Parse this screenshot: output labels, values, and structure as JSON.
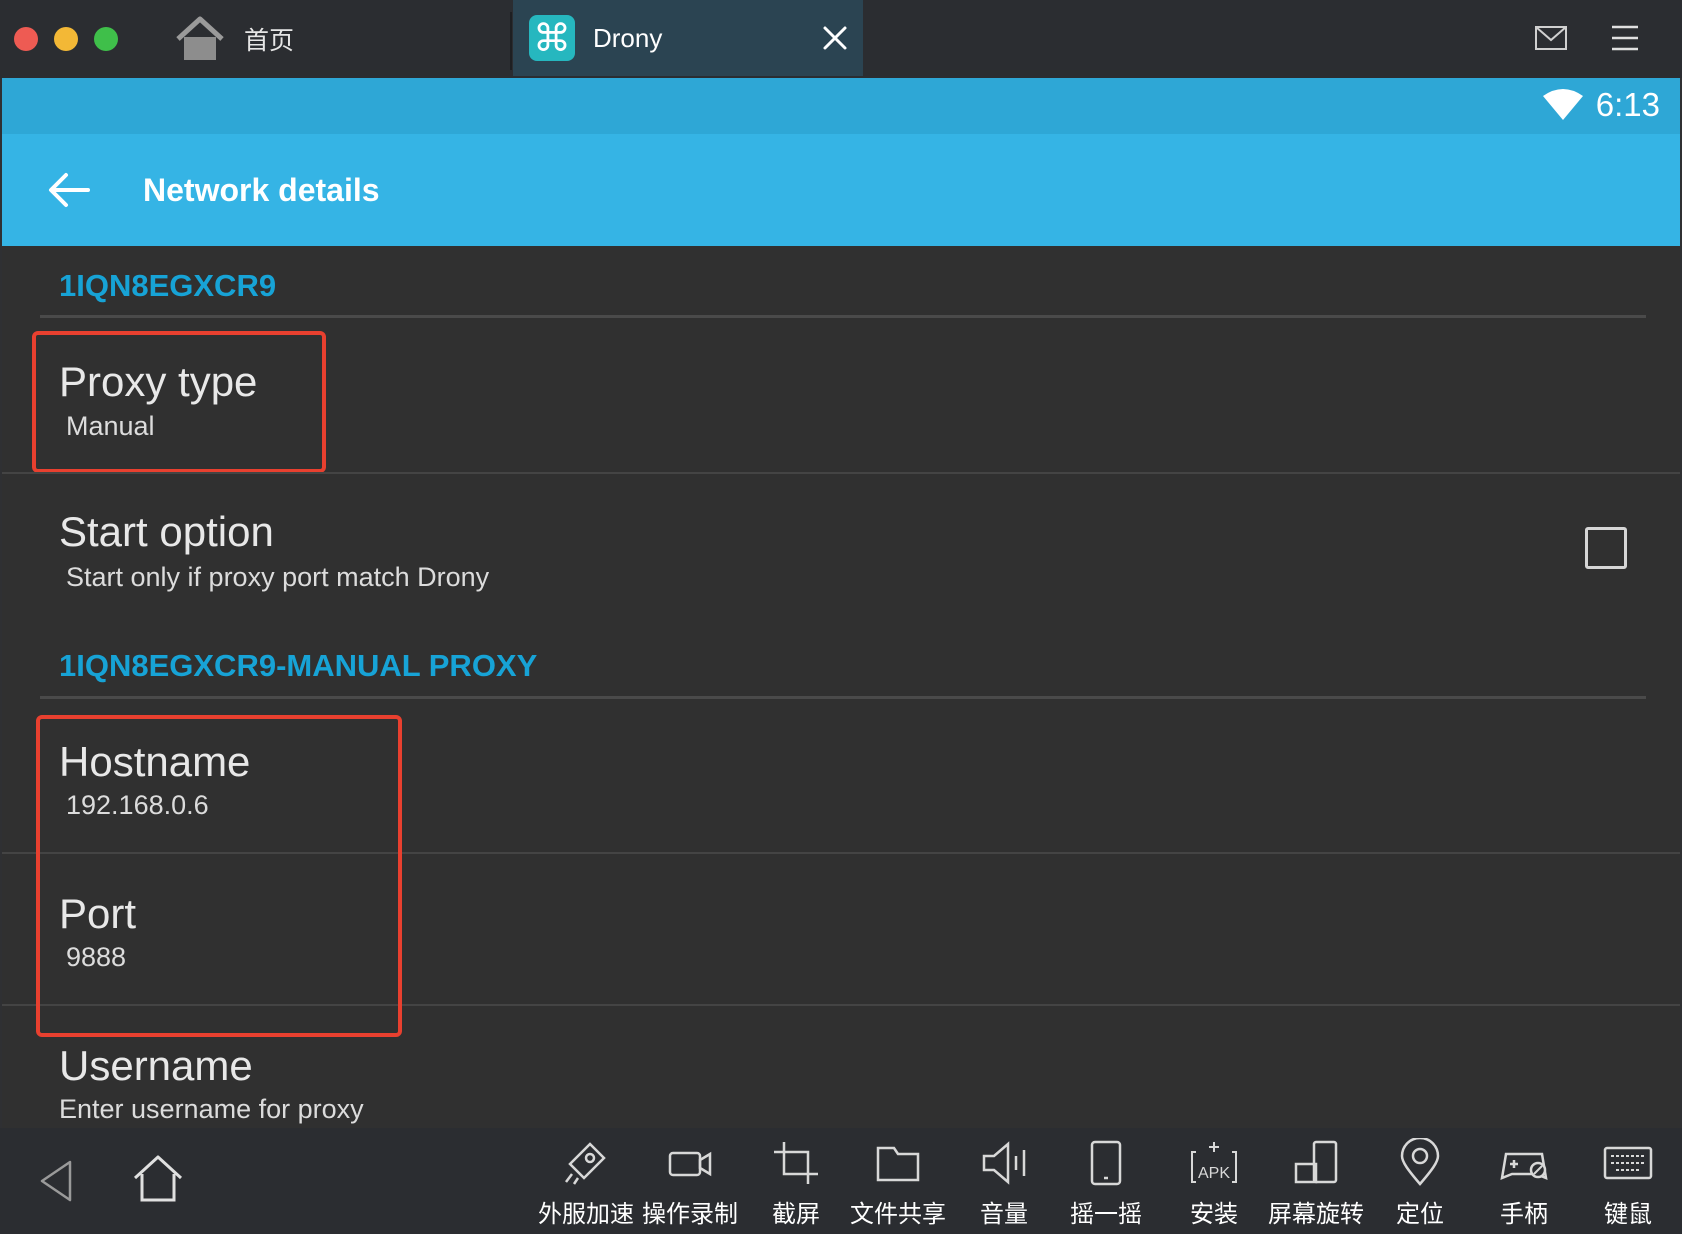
{
  "window": {
    "home_tab_label": "首页",
    "active_tab_label": "Drony"
  },
  "status_bar": {
    "time": "6:13"
  },
  "action_bar": {
    "title": "Network details"
  },
  "sections": [
    {
      "header": "1IQN8EGXCR9"
    },
    {
      "header": "1IQN8EGXCR9-MANUAL PROXY"
    }
  ],
  "settings": {
    "proxy_type": {
      "title": "Proxy type",
      "value": "Manual"
    },
    "start_option": {
      "title": "Start option",
      "summary": "Start only if proxy port match Drony",
      "checked": false
    },
    "hostname": {
      "title": "Hostname",
      "value": "192.168.0.6"
    },
    "port": {
      "title": "Port",
      "value": "9888"
    },
    "username": {
      "title": "Username",
      "summary": "Enter username for proxy"
    }
  },
  "toolbar": [
    {
      "label": "外服加速",
      "icon": "rocket-icon"
    },
    {
      "label": "操作录制",
      "icon": "video-camera-icon"
    },
    {
      "label": "截屏",
      "icon": "crop-icon"
    },
    {
      "label": "文件共享",
      "icon": "folder-icon"
    },
    {
      "label": "音量",
      "icon": "volume-icon"
    },
    {
      "label": "摇一摇",
      "icon": "shake-phone-icon"
    },
    {
      "label": "安装",
      "icon": "apk-install-icon"
    },
    {
      "label": "屏幕旋转",
      "icon": "screen-rotate-icon"
    },
    {
      "label": "定位",
      "icon": "location-pin-icon"
    },
    {
      "label": "手柄",
      "icon": "gamepad-icon"
    },
    {
      "label": "键鼠",
      "icon": "keyboard-icon"
    }
  ],
  "colors": {
    "accent": "#35b4e5",
    "section_header": "#17a3d6",
    "highlight_box": "#e8402f",
    "background": "#303030"
  }
}
